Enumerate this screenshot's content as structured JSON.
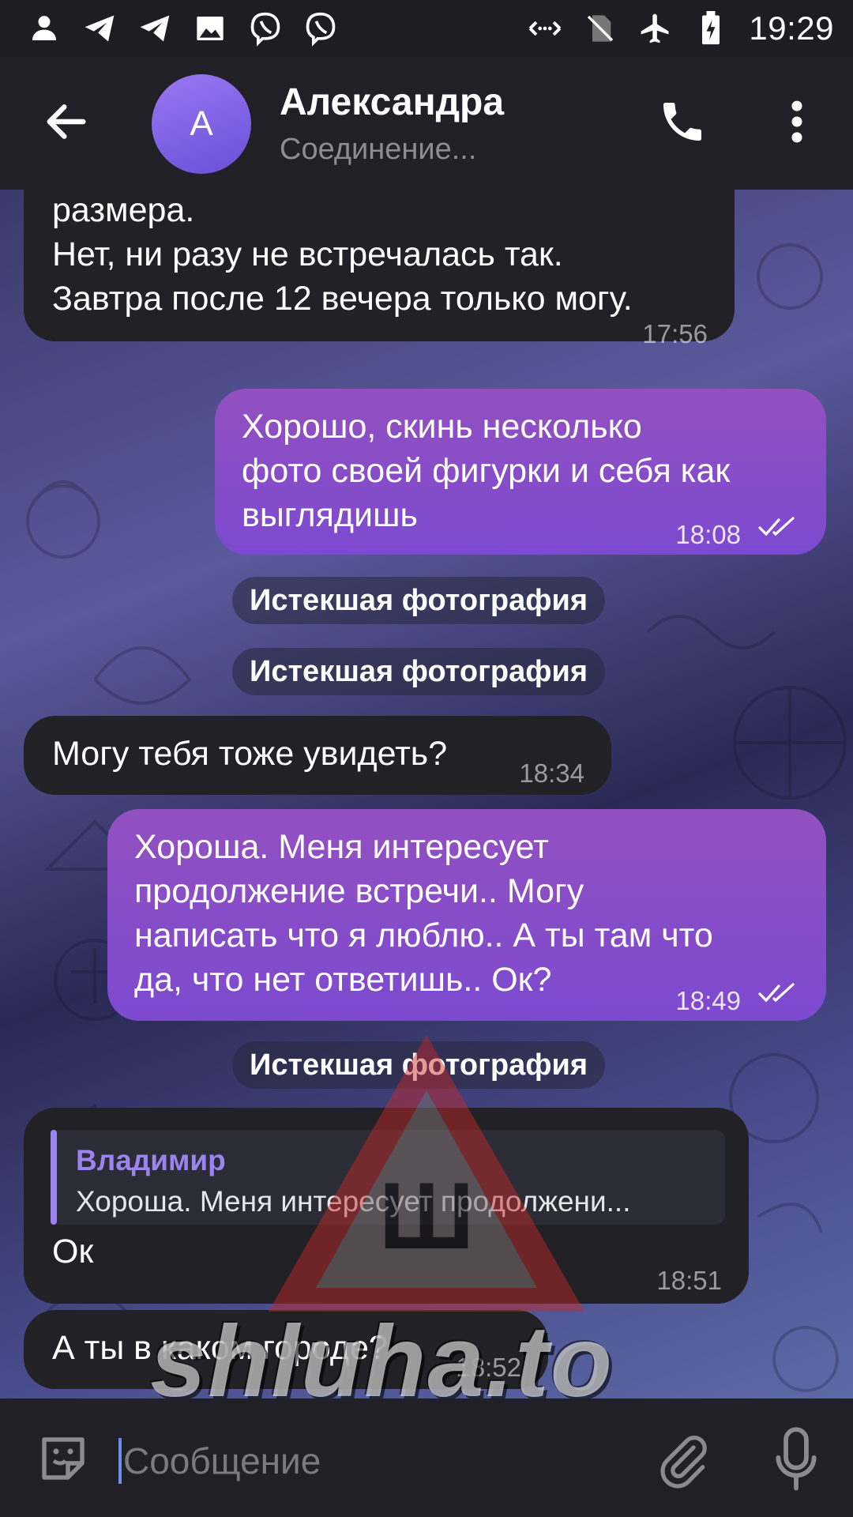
{
  "status_bar": {
    "time": "19:29",
    "left_icons": [
      "person-icon",
      "telegram-icon",
      "telegram-icon",
      "gallery-icon",
      "viber-icon",
      "viber-icon"
    ],
    "right_icons": [
      "data-sync-icon",
      "no-sim-icon",
      "airplane-mode-icon",
      "battery-charging-icon"
    ]
  },
  "header": {
    "avatar_letter": "A",
    "contact_name": "Александра",
    "status": "Соединение...",
    "back_icon": "arrow-left-icon",
    "call_icon": "phone-icon",
    "menu_icon": "more-vert-icon"
  },
  "messages": [
    {
      "type": "in",
      "lines": [
        "размера.",
        "Нет, ни разу не встречалась так.",
        "Завтра после 12 вечера только могу."
      ],
      "time": "17:56"
    },
    {
      "type": "out",
      "lines": [
        "Хорошо, скинь несколько",
        "фото своей фигурки и себя как",
        "выглядишь"
      ],
      "time": "18:08",
      "read": true
    },
    {
      "type": "service",
      "text": "Истекшая фотография"
    },
    {
      "type": "service",
      "text": "Истекшая фотография"
    },
    {
      "type": "in",
      "lines": [
        "Могу тебя тоже увидеть?"
      ],
      "time": "18:34"
    },
    {
      "type": "out",
      "lines": [
        "Хороша. Меня интересует",
        "продолжение встречи.. Могу",
        "написать что я люблю.. А ты там что",
        "да, что нет ответишь.. Ок?"
      ],
      "time": "18:49",
      "read": true
    },
    {
      "type": "service",
      "text": "Истекшая фотография"
    },
    {
      "type": "in",
      "reply": {
        "name": "Владимир",
        "text": "Хороша. Меня интересует продолжени..."
      },
      "lines": [
        "Ок"
      ],
      "time": "18:51"
    },
    {
      "type": "in",
      "lines": [
        "А ты в каком городе?"
      ],
      "time": "18:52"
    }
  ],
  "watermark": {
    "text": "shluha.to",
    "logo_letter": "Ш"
  },
  "input": {
    "placeholder": "Сообщение",
    "value": "",
    "emoji_icon": "sticker-icon",
    "attach_icon": "paperclip-icon",
    "mic_icon": "microphone-icon"
  },
  "colors": {
    "outgoing_bubble": "#8a4ccb",
    "incoming_bubble": "#212126",
    "accent": "#9c84f0",
    "header_bg": "#212026"
  }
}
